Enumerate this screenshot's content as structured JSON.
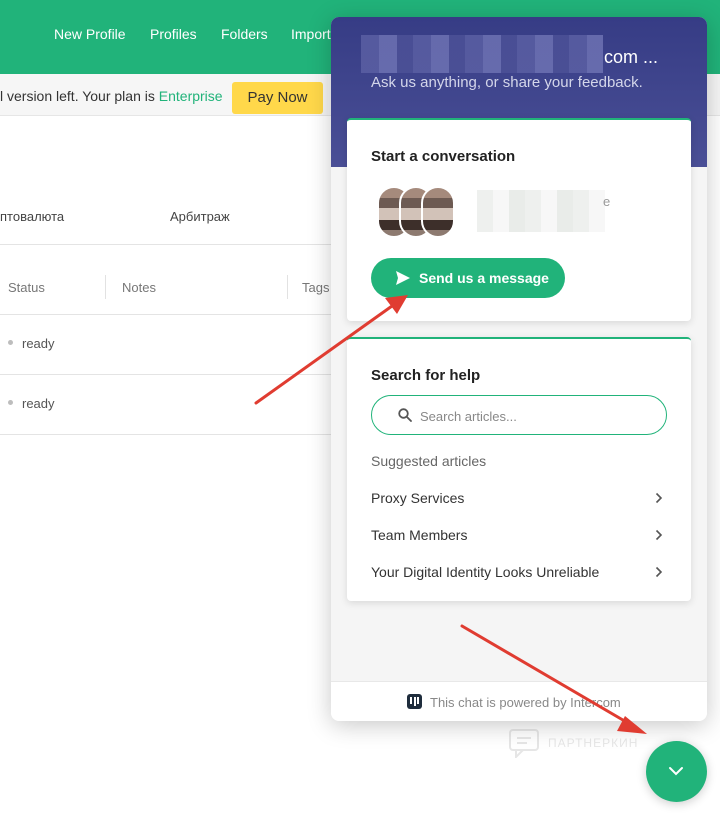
{
  "nav": {
    "items": [
      {
        "label": "New Profile"
      },
      {
        "label": "Profiles"
      },
      {
        "label": "Folders"
      },
      {
        "label": "Import"
      }
    ]
  },
  "banner": {
    "text_prefix": "l version left. Your plan is ",
    "plan_link": "Enterprise",
    "pay_now": "Pay Now"
  },
  "background_page": {
    "folder_tabs": [
      "птовалюта",
      "Арбитраж"
    ],
    "columns": [
      "Status",
      "Notes",
      "Tags"
    ],
    "rows": [
      {
        "status": "ready"
      },
      {
        "status": "ready"
      }
    ]
  },
  "messenger": {
    "title_suffix": "com ...",
    "subtitle": "Ask us anything, or share your feedback.",
    "conversation": {
      "title": "Start a conversation",
      "team_suffix": "e",
      "send_button": "Send us a message"
    },
    "search": {
      "title": "Search for help",
      "placeholder": "Search articles...",
      "suggested_label": "Suggested articles",
      "articles": [
        {
          "label": "Proxy Services"
        },
        {
          "label": "Team Members"
        },
        {
          "label": "Your Digital Identity Looks Unreliable"
        }
      ]
    },
    "footer": "This chat is powered by Intercom"
  },
  "watermark": {
    "text": "ПАРТНЕРКИН"
  },
  "colors": {
    "brand_green": "#21b37a",
    "header_navy": "#363c85",
    "pay_yellow": "#ffd84a",
    "arrow_red": "#e03c31"
  },
  "icons": [
    "send-icon",
    "search-icon",
    "chevron-right-icon",
    "chevron-down-icon",
    "intercom-logo-icon"
  ]
}
